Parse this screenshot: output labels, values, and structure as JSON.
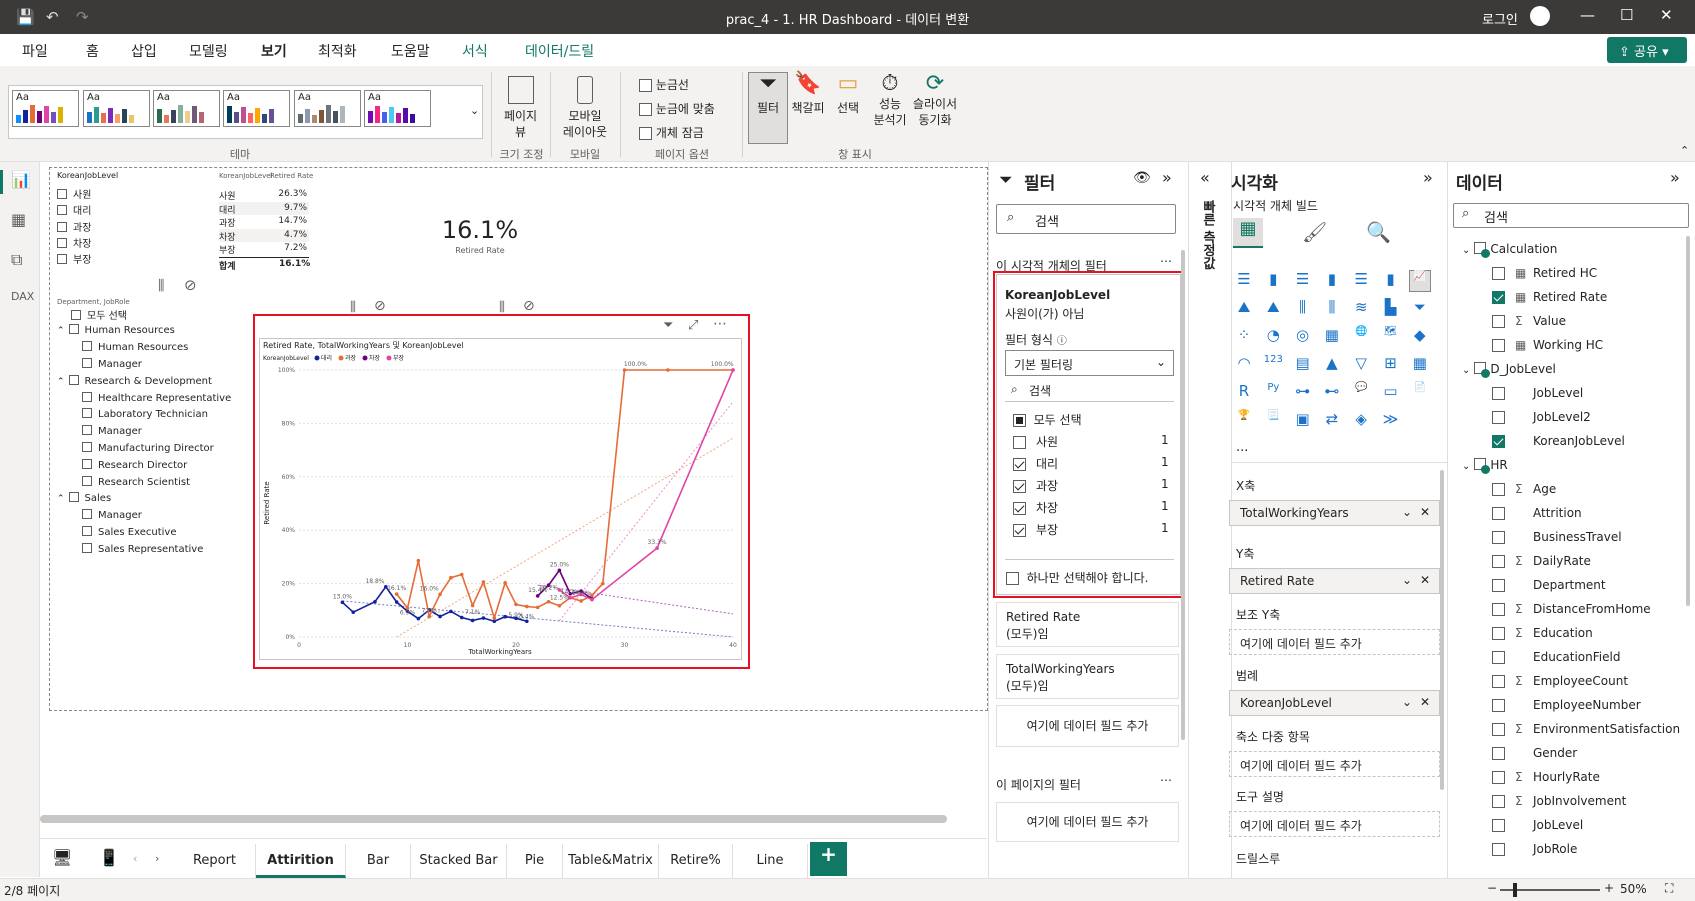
{
  "titlebar": {
    "title": "prac_4 - 1. HR Dashboard - 데이터 변환",
    "login": "로그인"
  },
  "menu": [
    "파일",
    "홈",
    "삽입",
    "모델링",
    "보기",
    "최적화",
    "도움말",
    "서식",
    "데이터/드릴"
  ],
  "share_label": "공유",
  "ribbon": {
    "theme_label": "테마",
    "size_label": "크기 조정",
    "page_view": "페이지",
    "page_view2": "뷰",
    "mobile_label": "모바일",
    "mobile_layout": "모바일",
    "mobile_layout2": "레이아웃",
    "page_options_label": "페이지 옵션",
    "gridlines": "눈금선",
    "snap": "눈금에 맞춤",
    "lock": "개체 잠금",
    "show_pane_label": "창 표시",
    "filter": "필터",
    "bookmark": "책갈피",
    "selection": "선택",
    "perf": "성능",
    "perf2": "분석기",
    "sync": "슬라이서",
    "sync2": "동기화"
  },
  "slicer1": {
    "title": "KoreanJobLevel",
    "items": [
      "사원",
      "대리",
      "과장",
      "차장",
      "부장"
    ]
  },
  "table1": {
    "headers": [
      "KoreanJobLevel",
      "Retired Rate"
    ],
    "rows": [
      [
        "사원",
        "26.3%"
      ],
      [
        "대리",
        "9.7%"
      ],
      [
        "과장",
        "14.7%"
      ],
      [
        "차장",
        "4.7%"
      ],
      [
        "부장",
        "7.2%"
      ]
    ],
    "total": [
      "합계",
      "16.1%"
    ]
  },
  "card1": {
    "value": "16.1%",
    "label": "Retired Rate"
  },
  "slicer2": {
    "title": "Department, JobRole",
    "select_all": "모두 선택",
    "groups": [
      {
        "name": "Human Resources",
        "items": [
          "Human Resources",
          "Manager"
        ]
      },
      {
        "name": "Research & Development",
        "items": [
          "Healthcare Representative",
          "Laboratory Technician",
          "Manager",
          "Manufacturing Director",
          "Research Director",
          "Research Scientist"
        ]
      },
      {
        "name": "Sales",
        "items": [
          "Manager",
          "Sales Executive",
          "Sales Representative"
        ]
      }
    ]
  },
  "chart_data": {
    "type": "line",
    "title": "Retired Rate, TotalWorkingYears 및 KoreanJobLevel",
    "xlabel": "TotalWorkingYears",
    "ylabel": "Retired Rate",
    "legend_title": "KoreanJobLevel",
    "xlim": [
      0,
      40
    ],
    "ylim": [
      0,
      100
    ],
    "xticks": [
      "0",
      "10",
      "20",
      "30",
      "40"
    ],
    "yticks": [
      "0%",
      "20%",
      "40%",
      "60%",
      "80%",
      "100%"
    ],
    "grid": true,
    "legend": "top-left",
    "trendlines": true,
    "series": [
      {
        "name": "대리",
        "color": "#12239e",
        "x": [
          4,
          5,
          7,
          8,
          9,
          10,
          11,
          12,
          13,
          14,
          15,
          16,
          17,
          18,
          19,
          20,
          21
        ],
        "y": [
          13.0,
          9.3,
          13.2,
          18.8,
          13.1,
          9.6,
          6.9,
          10.1,
          7.7,
          9.6,
          7.3,
          6.2,
          7.1,
          5.9,
          7.6,
          7.0,
          5.9
        ]
      },
      {
        "name": "과장",
        "color": "#e66c37",
        "x": [
          9,
          10,
          11,
          12,
          13,
          14,
          15,
          16,
          17,
          18,
          19,
          20,
          21,
          22,
          23,
          24,
          25,
          26,
          27,
          28,
          30,
          34,
          40
        ],
        "y": [
          16.1,
          10.8,
          28.6,
          7.7,
          16.0,
          22.2,
          23.4,
          11.8,
          20.6,
          7.1,
          20.3,
          12.2,
          11.4,
          11.1,
          13.2,
          11.7,
          14.7,
          13.5,
          15.6,
          20.0,
          100.0,
          100.0,
          100.0
        ]
      },
      {
        "name": "차장",
        "color": "#6b007b",
        "x": [
          22,
          23,
          24,
          25,
          26,
          27
        ],
        "y": [
          15.4,
          19.4,
          25.0,
          16.2,
          17.2,
          14.3
        ]
      },
      {
        "name": "부장",
        "color": "#e044a7",
        "x": [
          24,
          25,
          26,
          27,
          33,
          40
        ],
        "y": [
          17.6,
          14.7,
          15.9,
          14.0,
          33.3,
          100.0
        ]
      }
    ],
    "labels": [
      {
        "x": 4,
        "y": 13.0,
        "t": "13.0%"
      },
      {
        "x": 7,
        "y": 18.8,
        "t": "18.8%"
      },
      {
        "x": 9,
        "y": 16.1,
        "t": "16.1%"
      },
      {
        "x": 12,
        "y": 16.0,
        "t": "16.0%"
      },
      {
        "x": 10,
        "y": 6.9,
        "t": "6.9%"
      },
      {
        "x": 12,
        "y": 7.7,
        "t": "7.7%"
      },
      {
        "x": 16,
        "y": 7.1,
        "t": "7.1%"
      },
      {
        "x": 20,
        "y": 5.9,
        "t": "5.9%"
      },
      {
        "x": 21,
        "y": 5.4,
        "t": "5.4%"
      },
      {
        "x": 22,
        "y": 15.4,
        "t": "15.4%"
      },
      {
        "x": 24,
        "y": 25.0,
        "t": "25.0%"
      },
      {
        "x": 23,
        "y": 16.2,
        "t": "16.2%"
      },
      {
        "x": 26,
        "y": 14.3,
        "t": "14.3%"
      },
      {
        "x": 25,
        "y": 14.7,
        "t": "14.7%"
      },
      {
        "x": 24,
        "y": 12.5,
        "t": "12.5%"
      },
      {
        "x": 33,
        "y": 33.3,
        "t": "33.3%"
      },
      {
        "x": 31,
        "y": 100,
        "t": "100.0%"
      },
      {
        "x": 39,
        "y": 100,
        "t": "100.0%"
      }
    ]
  },
  "filters_pane": {
    "title": "필터",
    "search": "검색",
    "visual_filters": "이 시각적 개체의 필터",
    "card": {
      "field": "KoreanJobLevel",
      "desc": "사원이(가) 아님",
      "type_label": "필터 형식",
      "type_value": "기본 필터링",
      "search": "검색",
      "select_all": "모두 선택",
      "items": [
        {
          "name": "사원",
          "count": "1",
          "checked": false
        },
        {
          "name": "대리",
          "count": "1",
          "checked": true
        },
        {
          "name": "과장",
          "count": "1",
          "checked": true
        },
        {
          "name": "차장",
          "count": "1",
          "checked": true
        },
        {
          "name": "부장",
          "count": "1",
          "checked": true
        }
      ],
      "single": "하나만 선택해야 합니다."
    },
    "rr": {
      "field": "Retired Rate",
      "desc": "(모두)임"
    },
    "twy": {
      "field": "TotalWorkingYears",
      "desc": "(모두)임"
    },
    "add": "여기에 데이터 필드 추가",
    "page_filters": "이 페이지의 필터",
    "add2": "여기에 데이터 필드 추가"
  },
  "viz_pane": {
    "title": "시각화",
    "build": "시각적 개체 빌드",
    "more": "...",
    "wells": [
      {
        "label": "X축",
        "value": "TotalWorkingYears",
        "filled": true
      },
      {
        "label": "Y축",
        "value": "Retired Rate",
        "filled": true
      },
      {
        "label": "보조 Y축",
        "value": "여기에 데이터 필드 추가",
        "filled": false
      },
      {
        "label": "범례",
        "value": "KoreanJobLevel",
        "filled": true
      },
      {
        "label": "축소 다중 항목",
        "value": "여기에 데이터 필드 추가",
        "filled": false
      },
      {
        "label": "도구 설명",
        "value": "여기에 데이터 필드 추가",
        "filled": false
      }
    ],
    "drill": "드릴스루"
  },
  "data_pane": {
    "title": "데이터",
    "search": "검색",
    "tables": [
      {
        "name": "Calculation",
        "fields": [
          {
            "n": "Retired HC",
            "t": "calc",
            "c": false
          },
          {
            "n": "Retired Rate",
            "t": "calc",
            "c": true
          },
          {
            "n": "Value",
            "t": "sum",
            "c": false
          },
          {
            "n": "Working HC",
            "t": "calc",
            "c": false
          }
        ]
      },
      {
        "name": "D_JobLevel",
        "fields": [
          {
            "n": "JobLevel",
            "t": "",
            "c": false
          },
          {
            "n": "JobLevel2",
            "t": "",
            "c": false
          },
          {
            "n": "KoreanJobLevel",
            "t": "",
            "c": true
          }
        ]
      },
      {
        "name": "HR",
        "fields": [
          {
            "n": "Age",
            "t": "sum",
            "c": false
          },
          {
            "n": "Attrition",
            "t": "",
            "c": false
          },
          {
            "n": "BusinessTravel",
            "t": "",
            "c": false
          },
          {
            "n": "DailyRate",
            "t": "sum",
            "c": false
          },
          {
            "n": "Department",
            "t": "",
            "c": false
          },
          {
            "n": "DistanceFromHome",
            "t": "sum",
            "c": false
          },
          {
            "n": "Education",
            "t": "sum",
            "c": false
          },
          {
            "n": "EducationField",
            "t": "",
            "c": false
          },
          {
            "n": "EmployeeCount",
            "t": "sum",
            "c": false
          },
          {
            "n": "EmployeeNumber",
            "t": "",
            "c": false
          },
          {
            "n": "EnvironmentSatisfaction",
            "t": "sum",
            "c": false
          },
          {
            "n": "Gender",
            "t": "",
            "c": false
          },
          {
            "n": "HourlyRate",
            "t": "sum",
            "c": false
          },
          {
            "n": "JobInvolvement",
            "t": "sum",
            "c": false
          },
          {
            "n": "JobLevel",
            "t": "",
            "c": false
          },
          {
            "n": "JobRole",
            "t": "",
            "c": false
          }
        ]
      }
    ]
  },
  "side_tab": "빠른 측정값",
  "tabs": [
    "Report",
    "Attirition",
    "Bar",
    "Stacked Bar",
    "Pie",
    "Table&Matrix",
    "Retire%",
    "Line"
  ],
  "status": {
    "page": "2/8 페이지",
    "zoom": "50%"
  }
}
